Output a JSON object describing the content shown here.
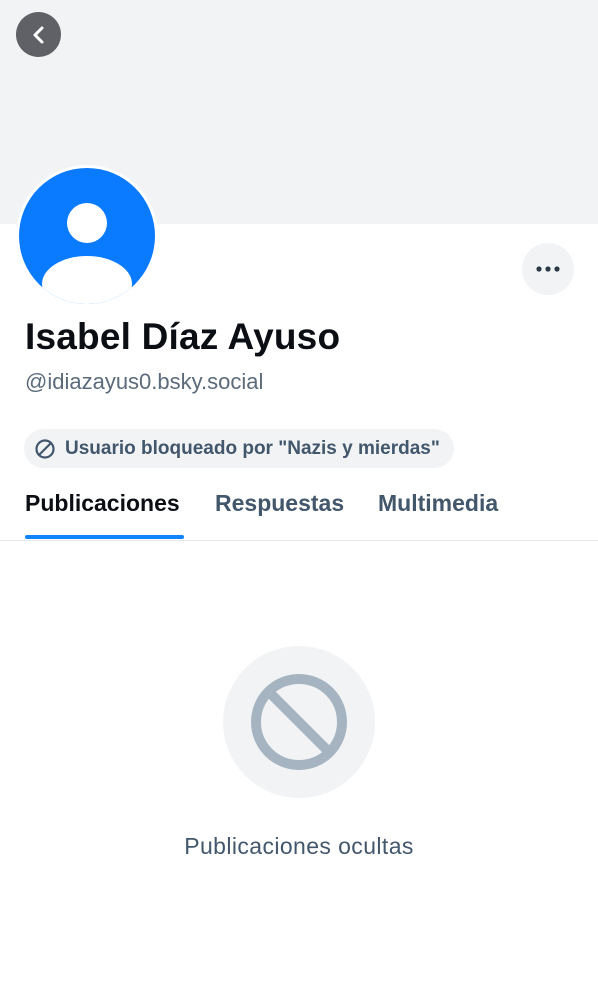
{
  "profile": {
    "display_name": "Isabel Díaz Ayuso",
    "handle": "@idiazayus0.bsky.social",
    "avatar_icon": "default-avatar-icon",
    "blocked_label": "Usuario bloqueado por \"Nazis y mierdas\"",
    "blocked_icon": "block-icon"
  },
  "header": {
    "back_icon": "chevron-left-icon",
    "more_icon": "ellipsis-icon"
  },
  "tabs": [
    {
      "label": "Publicaciones",
      "active": true
    },
    {
      "label": "Respuestas",
      "active": false
    },
    {
      "label": "Multimedia",
      "active": false
    }
  ],
  "feed": {
    "empty_icon": "block-icon",
    "empty_message": "Publicaciones ocultas"
  },
  "colors": {
    "accent": "#1083fe",
    "avatar_bg": "#0a7aff",
    "banner": "#f1f3f5",
    "muted_text": "#42576c"
  }
}
